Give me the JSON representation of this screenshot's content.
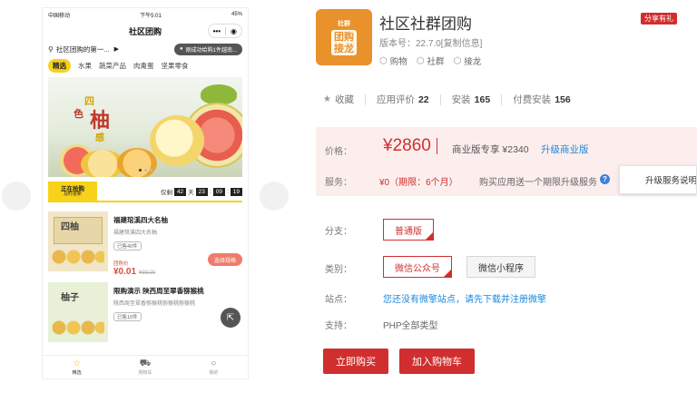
{
  "phone": {
    "status": {
      "carrier": "中国移动",
      "time": "下午5:01",
      "battery": "45%"
    },
    "header": {
      "title": "社区团购",
      "more": "•••"
    },
    "location": {
      "text": "社区团购的第一...",
      "notice": "刚成功给购1件越南..."
    },
    "categories": [
      "精选",
      "水果",
      "蔬菜产品",
      "肉禽蛋",
      "坚果零食"
    ],
    "banner": {
      "w1": "四",
      "w2": "色",
      "w3": "柚",
      "w4": "感"
    },
    "flash": {
      "title": "正在抢购",
      "subtitle": "及时更新",
      "prefix": "仅剩",
      "days": "42",
      "day_label": "天",
      "h": "23",
      "m": "09",
      "s": "19"
    },
    "products": [
      {
        "img_text": "四柚",
        "title": "福建琯溪四大名柚",
        "subtitle": "福建琯溪四大名柚",
        "badge": "已售40件",
        "price_label": "团购价",
        "price": "¥0.01",
        "old_price": "¥99.00",
        "button": "选择规格"
      },
      {
        "img_text": "柚子",
        "title": "限购演示 陕西周至翠香猕猴桃",
        "subtitle": "陕西周至翠香猕猴桃猕猴桃猕猴桃",
        "badge": "已售10件"
      }
    ],
    "tabs": [
      {
        "label": "精选",
        "icon": "star-icon"
      },
      {
        "label": "购物车",
        "icon": "cart-icon"
      },
      {
        "label": "我的",
        "icon": "user-icon"
      }
    ]
  },
  "app": {
    "logo": {
      "line1": "社群",
      "line2": "团购\n接龙"
    },
    "title": "社区社群团购",
    "version": "版本号：22.7.0[复制信息]",
    "tags": [
      "购物",
      "社群",
      "接龙"
    ],
    "share": "分享有礼"
  },
  "stats": {
    "collect": "收藏",
    "rating_label": "应用评价",
    "rating": "22",
    "install_label": "安装",
    "install": "165",
    "paid_label": "付费安装",
    "paid": "156"
  },
  "price": {
    "label": "价格：",
    "value": "¥2860",
    "biz": "商业版专享 ¥2340",
    "upgrade": "升级商业版",
    "service_label": "服务：",
    "service_value": "¥0（期限：6个月）",
    "service_desc": "购买应用送一个期限升级服务",
    "tooltip": "升级服务说明"
  },
  "options": {
    "branch_label": "分支：",
    "branch": "普通版",
    "type_label": "类别：",
    "types": [
      "微信公众号",
      "微信小程序"
    ],
    "site_label": "站点：",
    "site_text": "您还没有微擎站点，请先下载并注册微擎",
    "support_label": "支持：",
    "support_value": "PHP全部类型"
  },
  "actions": {
    "buy": "立即购买",
    "cart": "加入购物车"
  },
  "colors": {
    "accent": "#d12f2f",
    "link": "#1e88d9",
    "yellow": "#f7d21a",
    "logo": "#e9922c"
  }
}
